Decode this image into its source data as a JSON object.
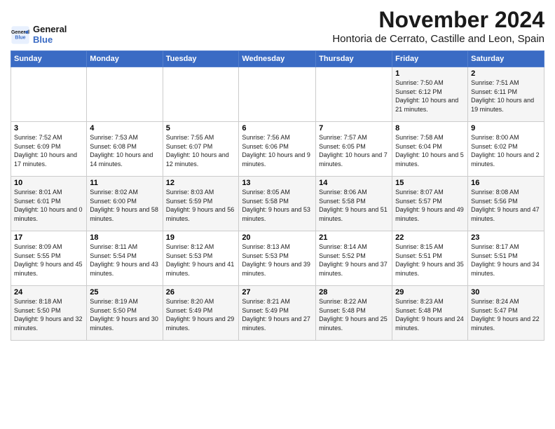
{
  "header": {
    "logo_line1": "General",
    "logo_line2": "Blue",
    "month": "November 2024",
    "location": "Hontoria de Cerrato, Castille and Leon, Spain"
  },
  "weekdays": [
    "Sunday",
    "Monday",
    "Tuesday",
    "Wednesday",
    "Thursday",
    "Friday",
    "Saturday"
  ],
  "weeks": [
    [
      {
        "day": "",
        "info": ""
      },
      {
        "day": "",
        "info": ""
      },
      {
        "day": "",
        "info": ""
      },
      {
        "day": "",
        "info": ""
      },
      {
        "day": "",
        "info": ""
      },
      {
        "day": "1",
        "info": "Sunrise: 7:50 AM\nSunset: 6:12 PM\nDaylight: 10 hours\nand 21 minutes."
      },
      {
        "day": "2",
        "info": "Sunrise: 7:51 AM\nSunset: 6:11 PM\nDaylight: 10 hours\nand 19 minutes."
      }
    ],
    [
      {
        "day": "3",
        "info": "Sunrise: 7:52 AM\nSunset: 6:09 PM\nDaylight: 10 hours\nand 17 minutes."
      },
      {
        "day": "4",
        "info": "Sunrise: 7:53 AM\nSunset: 6:08 PM\nDaylight: 10 hours\nand 14 minutes."
      },
      {
        "day": "5",
        "info": "Sunrise: 7:55 AM\nSunset: 6:07 PM\nDaylight: 10 hours\nand 12 minutes."
      },
      {
        "day": "6",
        "info": "Sunrise: 7:56 AM\nSunset: 6:06 PM\nDaylight: 10 hours\nand 9 minutes."
      },
      {
        "day": "7",
        "info": "Sunrise: 7:57 AM\nSunset: 6:05 PM\nDaylight: 10 hours\nand 7 minutes."
      },
      {
        "day": "8",
        "info": "Sunrise: 7:58 AM\nSunset: 6:04 PM\nDaylight: 10 hours\nand 5 minutes."
      },
      {
        "day": "9",
        "info": "Sunrise: 8:00 AM\nSunset: 6:02 PM\nDaylight: 10 hours\nand 2 minutes."
      }
    ],
    [
      {
        "day": "10",
        "info": "Sunrise: 8:01 AM\nSunset: 6:01 PM\nDaylight: 10 hours\nand 0 minutes."
      },
      {
        "day": "11",
        "info": "Sunrise: 8:02 AM\nSunset: 6:00 PM\nDaylight: 9 hours\nand 58 minutes."
      },
      {
        "day": "12",
        "info": "Sunrise: 8:03 AM\nSunset: 5:59 PM\nDaylight: 9 hours\nand 56 minutes."
      },
      {
        "day": "13",
        "info": "Sunrise: 8:05 AM\nSunset: 5:58 PM\nDaylight: 9 hours\nand 53 minutes."
      },
      {
        "day": "14",
        "info": "Sunrise: 8:06 AM\nSunset: 5:58 PM\nDaylight: 9 hours\nand 51 minutes."
      },
      {
        "day": "15",
        "info": "Sunrise: 8:07 AM\nSunset: 5:57 PM\nDaylight: 9 hours\nand 49 minutes."
      },
      {
        "day": "16",
        "info": "Sunrise: 8:08 AM\nSunset: 5:56 PM\nDaylight: 9 hours\nand 47 minutes."
      }
    ],
    [
      {
        "day": "17",
        "info": "Sunrise: 8:09 AM\nSunset: 5:55 PM\nDaylight: 9 hours\nand 45 minutes."
      },
      {
        "day": "18",
        "info": "Sunrise: 8:11 AM\nSunset: 5:54 PM\nDaylight: 9 hours\nand 43 minutes."
      },
      {
        "day": "19",
        "info": "Sunrise: 8:12 AM\nSunset: 5:53 PM\nDaylight: 9 hours\nand 41 minutes."
      },
      {
        "day": "20",
        "info": "Sunrise: 8:13 AM\nSunset: 5:53 PM\nDaylight: 9 hours\nand 39 minutes."
      },
      {
        "day": "21",
        "info": "Sunrise: 8:14 AM\nSunset: 5:52 PM\nDaylight: 9 hours\nand 37 minutes."
      },
      {
        "day": "22",
        "info": "Sunrise: 8:15 AM\nSunset: 5:51 PM\nDaylight: 9 hours\nand 35 minutes."
      },
      {
        "day": "23",
        "info": "Sunrise: 8:17 AM\nSunset: 5:51 PM\nDaylight: 9 hours\nand 34 minutes."
      }
    ],
    [
      {
        "day": "24",
        "info": "Sunrise: 8:18 AM\nSunset: 5:50 PM\nDaylight: 9 hours\nand 32 minutes."
      },
      {
        "day": "25",
        "info": "Sunrise: 8:19 AM\nSunset: 5:50 PM\nDaylight: 9 hours\nand 30 minutes."
      },
      {
        "day": "26",
        "info": "Sunrise: 8:20 AM\nSunset: 5:49 PM\nDaylight: 9 hours\nand 29 minutes."
      },
      {
        "day": "27",
        "info": "Sunrise: 8:21 AM\nSunset: 5:49 PM\nDaylight: 9 hours\nand 27 minutes."
      },
      {
        "day": "28",
        "info": "Sunrise: 8:22 AM\nSunset: 5:48 PM\nDaylight: 9 hours\nand 25 minutes."
      },
      {
        "day": "29",
        "info": "Sunrise: 8:23 AM\nSunset: 5:48 PM\nDaylight: 9 hours\nand 24 minutes."
      },
      {
        "day": "30",
        "info": "Sunrise: 8:24 AM\nSunset: 5:47 PM\nDaylight: 9 hours\nand 22 minutes."
      }
    ]
  ]
}
